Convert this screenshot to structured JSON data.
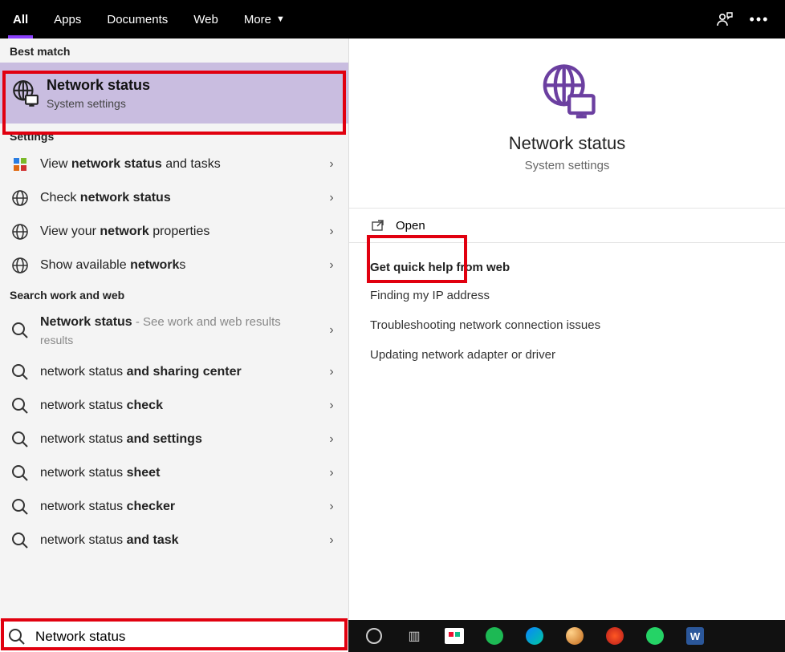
{
  "topbar": {
    "filters": [
      "All",
      "Apps",
      "Documents",
      "Web",
      "More"
    ],
    "active_index": 0
  },
  "left": {
    "best_match_header": "Best match",
    "best_match": {
      "title": "Network status",
      "subtitle": "System settings"
    },
    "settings_header": "Settings",
    "settings_items": [
      {
        "prefix": "View ",
        "bold": "network status",
        "suffix": " and tasks"
      },
      {
        "prefix": "Check ",
        "bold": "network status",
        "suffix": ""
      },
      {
        "prefix": "View your ",
        "bold": "network",
        "suffix": " properties"
      },
      {
        "prefix": "Show available ",
        "bold": "network",
        "suffix": "s"
      }
    ],
    "web_header": "Search work and web",
    "web_items": [
      {
        "bold": "Network status",
        "suffix": " - See work and web results",
        "sub": "",
        "wrap": true
      },
      {
        "plain": "network status ",
        "bold2": "and sharing center"
      },
      {
        "plain": "network status ",
        "bold2": "check"
      },
      {
        "plain": "network status ",
        "bold2": "and settings"
      },
      {
        "plain": "network status ",
        "bold2": "sheet"
      },
      {
        "plain": "network status ",
        "bold2": "checker"
      },
      {
        "plain": "network status ",
        "bold2": "and task"
      }
    ]
  },
  "right": {
    "title": "Network status",
    "subtitle": "System settings",
    "open_label": "Open",
    "help_header": "Get quick help from web",
    "help_links": [
      "Finding my IP address",
      "Troubleshooting network connection issues",
      "Updating network adapter or driver"
    ]
  },
  "search": {
    "value": "Network status"
  }
}
